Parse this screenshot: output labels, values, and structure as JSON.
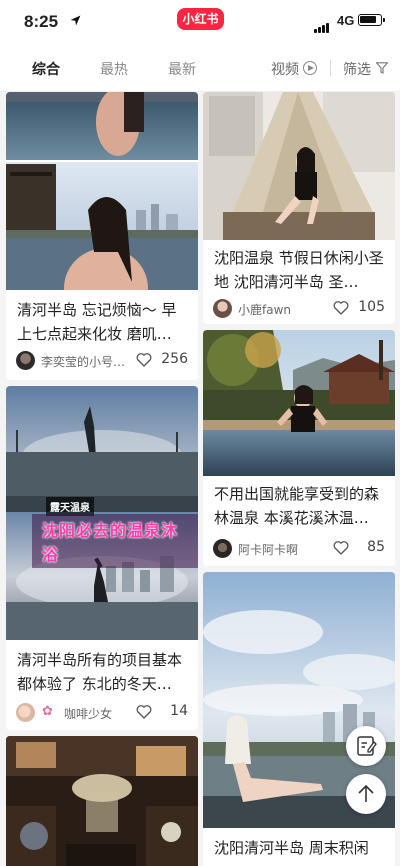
{
  "status_bar": {
    "time": "8:25",
    "network": "4G",
    "app_badge": "小红书"
  },
  "filter_bar": {
    "tabs": [
      {
        "label": "综合",
        "active": true
      },
      {
        "label": "最热",
        "active": false
      },
      {
        "label": "最新",
        "active": false
      }
    ],
    "video_label": "视频",
    "filter_label": "筛选"
  },
  "feed": {
    "left": [
      {
        "title": "清河半岛 忘记烦恼～ 早上七点起来化妆 磨叽…",
        "author": "李奕莹的小号…",
        "likes": "256",
        "avatar_icon": "avatar-photo"
      },
      {
        "title": "清河半岛所有的项目基本都体验了 东北的冬天…",
        "author": "咖啡少女",
        "likes": "14",
        "avatar_icon": "flower-icon",
        "overlay_tag": "露天温泉",
        "overlay_banner": "沈阳必去的温泉沐浴"
      },
      {
        "title": ""
      }
    ],
    "right": [
      {
        "title": "沈阳温泉 节假日休闲小圣地 沈阳清河半岛 圣…",
        "author": "小鹿fawn",
        "likes": "105",
        "avatar_icon": "avatar-photo"
      },
      {
        "title": "不用出国就能享受到的森林温泉 本溪花溪沐温…",
        "author": "阿卡阿卡啊",
        "likes": "85",
        "avatar_icon": "avatar-photo"
      },
      {
        "title": "沈阳清河半岛 周末积闲"
      }
    ]
  },
  "fabs": {
    "compose_icon": "edit-note-icon",
    "top_icon": "arrow-up-icon"
  },
  "colors": {
    "brand": "#ff2442",
    "background": "#f4f4f4"
  }
}
